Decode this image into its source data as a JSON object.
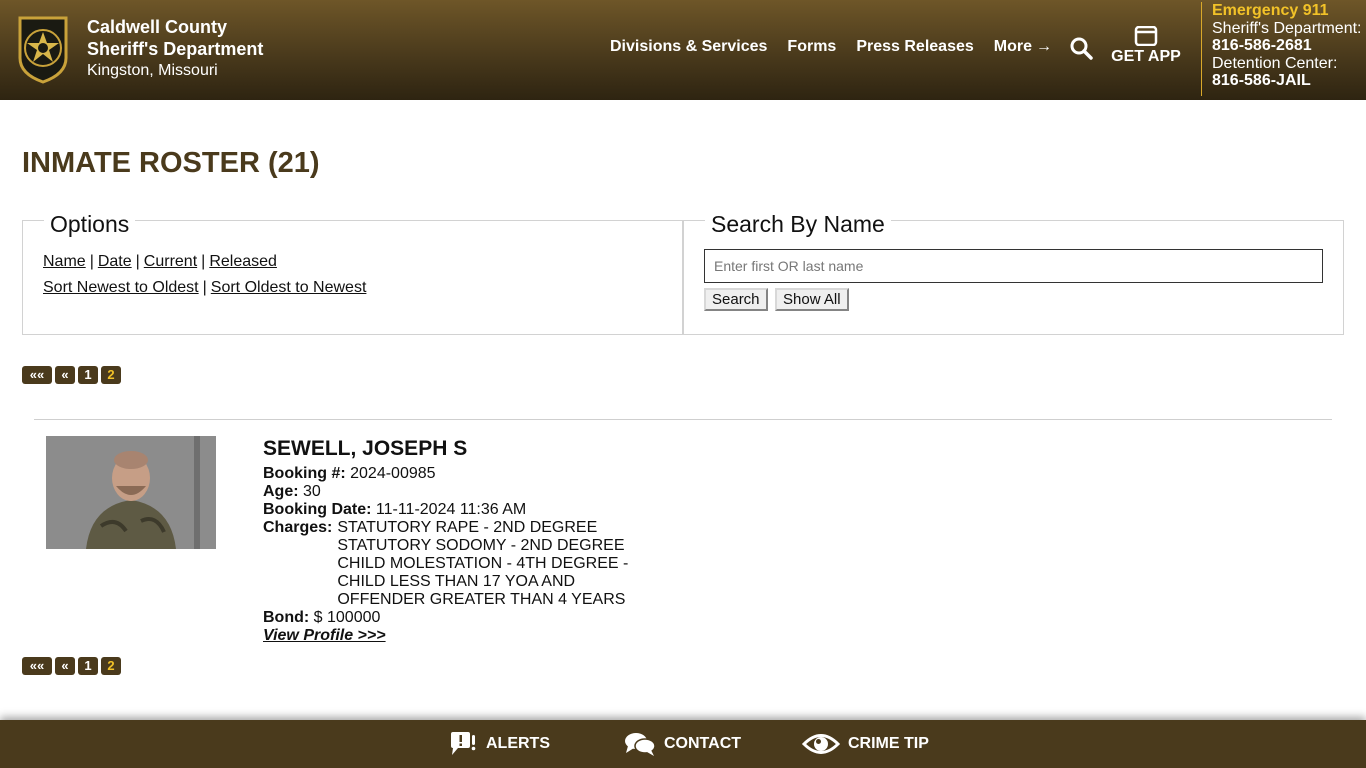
{
  "header": {
    "org_line1": "Caldwell County",
    "org_line2": "Sheriff's Department",
    "org_line3": "Kingston, Missouri",
    "nav": [
      {
        "label": "Divisions & Services"
      },
      {
        "label": "Forms"
      },
      {
        "label": "Press Releases"
      },
      {
        "label": "More"
      }
    ],
    "more_arrow": "→",
    "get_app_label": "GET APP",
    "emergency_label": "Emergency 911",
    "sheriff_label": "Sheriff's Department:",
    "sheriff_phone": "816-586-2681",
    "detention_label": "Detention Center:",
    "detention_phone": "816-586-JAIL",
    "icons": {
      "badge": "sheriff-badge-logo",
      "search": "search-icon",
      "app": "phone-icon"
    }
  },
  "page": {
    "title": "INMATE ROSTER (21)"
  },
  "options": {
    "legend": "Options",
    "sort_links": [
      "Name",
      "Date",
      "Current",
      "Released"
    ],
    "order_links": [
      "Sort Newest to Oldest",
      "Sort Oldest to Newest"
    ],
    "separator": "|"
  },
  "search": {
    "legend": "Search By Name",
    "placeholder": "Enter first OR last name",
    "value": "",
    "search_button": "Search",
    "show_all_button": "Show All"
  },
  "pagination": {
    "first": "««",
    "prev": "«",
    "pages": [
      "1",
      "2"
    ],
    "current": "2"
  },
  "inmate": {
    "name": "SEWELL, JOSEPH S",
    "booking_label": "Booking #:",
    "booking_number": "2024-00985",
    "age_label": "Age:",
    "age": "30",
    "booking_date_label": "Booking Date:",
    "booking_date": "11-11-2024 11:36 AM",
    "charges_label": "Charges:",
    "charges": [
      "STATUTORY RAPE - 2ND DEGREE",
      "STATUTORY SODOMY - 2ND DEGREE",
      "CHILD MOLESTATION - 4TH DEGREE -",
      "CHILD LESS THAN 17 YOA AND",
      "OFFENDER GREATER THAN 4 YEARS"
    ],
    "bond_label": "Bond:",
    "bond": "$ 100000",
    "view_profile": "View Profile >>>"
  },
  "footer": {
    "alerts": "ALERTS",
    "contact": "CONTACT",
    "crime_tip": "CRIME TIP"
  },
  "colors": {
    "brand_brown": "#4a3a1c",
    "header_top": "#6e5628",
    "accent_gold": "#f2c228"
  }
}
